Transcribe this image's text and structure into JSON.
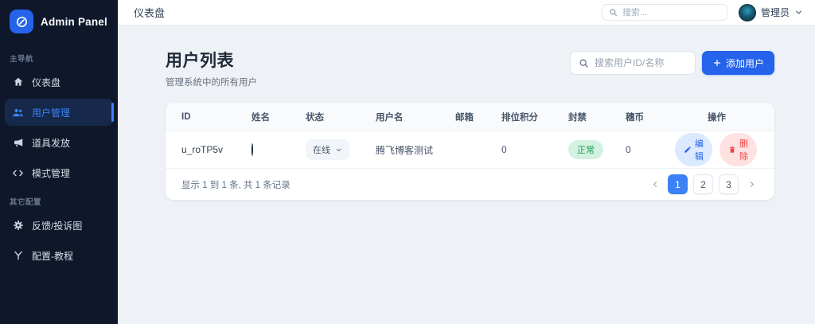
{
  "app": {
    "title": "Admin Panel"
  },
  "topbar": {
    "page_title": "仪表盘",
    "search_placeholder": "搜索...",
    "user_name": "管理员"
  },
  "sidebar": {
    "sections": [
      {
        "label": "主导航",
        "items": [
          {
            "label": "仪表盘"
          },
          {
            "label": "用户管理"
          },
          {
            "label": "道具发放"
          },
          {
            "label": "模式管理"
          }
        ]
      },
      {
        "label": "其它配置",
        "items": [
          {
            "label": "反馈/投诉图"
          },
          {
            "label": "配置-教程"
          }
        ]
      }
    ],
    "active_item": "用户管理"
  },
  "content": {
    "title": "用户列表",
    "subtitle": "管理系统中的所有用户",
    "search_placeholder": "搜索用户ID/名称",
    "add_user_label": "添加用户"
  },
  "table": {
    "columns": [
      "ID",
      "姓名",
      "状态",
      "用户名",
      "邮箱",
      "排位积分",
      "封禁",
      "穗币",
      "操作"
    ],
    "rows": [
      {
        "id": "u_roTP5v",
        "status": "在线",
        "username": "腾飞博客测试",
        "email": "",
        "rank_points": "0",
        "ban_status": "正常",
        "coins": "0",
        "edit_label": "编辑",
        "delete_label": "删除"
      }
    ]
  },
  "pagination": {
    "summary": "显示 1 到 1 条, 共 1 条记录",
    "pages": [
      "1",
      "2",
      "3"
    ],
    "active_page": "1"
  },
  "colors": {
    "accent_blue": "#2563eb",
    "sidebar_bg": "#0f172a",
    "success_green": "#18a058",
    "danger_red": "#ef4444",
    "main_bg": "#eef1f6"
  }
}
